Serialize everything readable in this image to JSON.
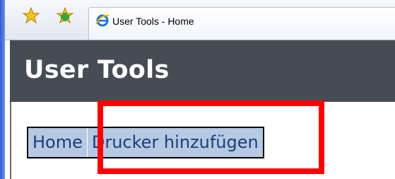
{
  "browser": {
    "tab_title": "User Tools - Home",
    "icons": [
      "favorites-star-icon",
      "add-favorite-icon",
      "ie-page-icon"
    ]
  },
  "page": {
    "title": "User Tools",
    "nav": {
      "home_label": "Home",
      "add_printer_label": "Drucker hinzufügen"
    }
  },
  "colors": {
    "header_bg": "#454c54",
    "nav_bg": "#b6c9e3",
    "nav_text": "#1f3c78",
    "highlight": "#ff0000"
  }
}
